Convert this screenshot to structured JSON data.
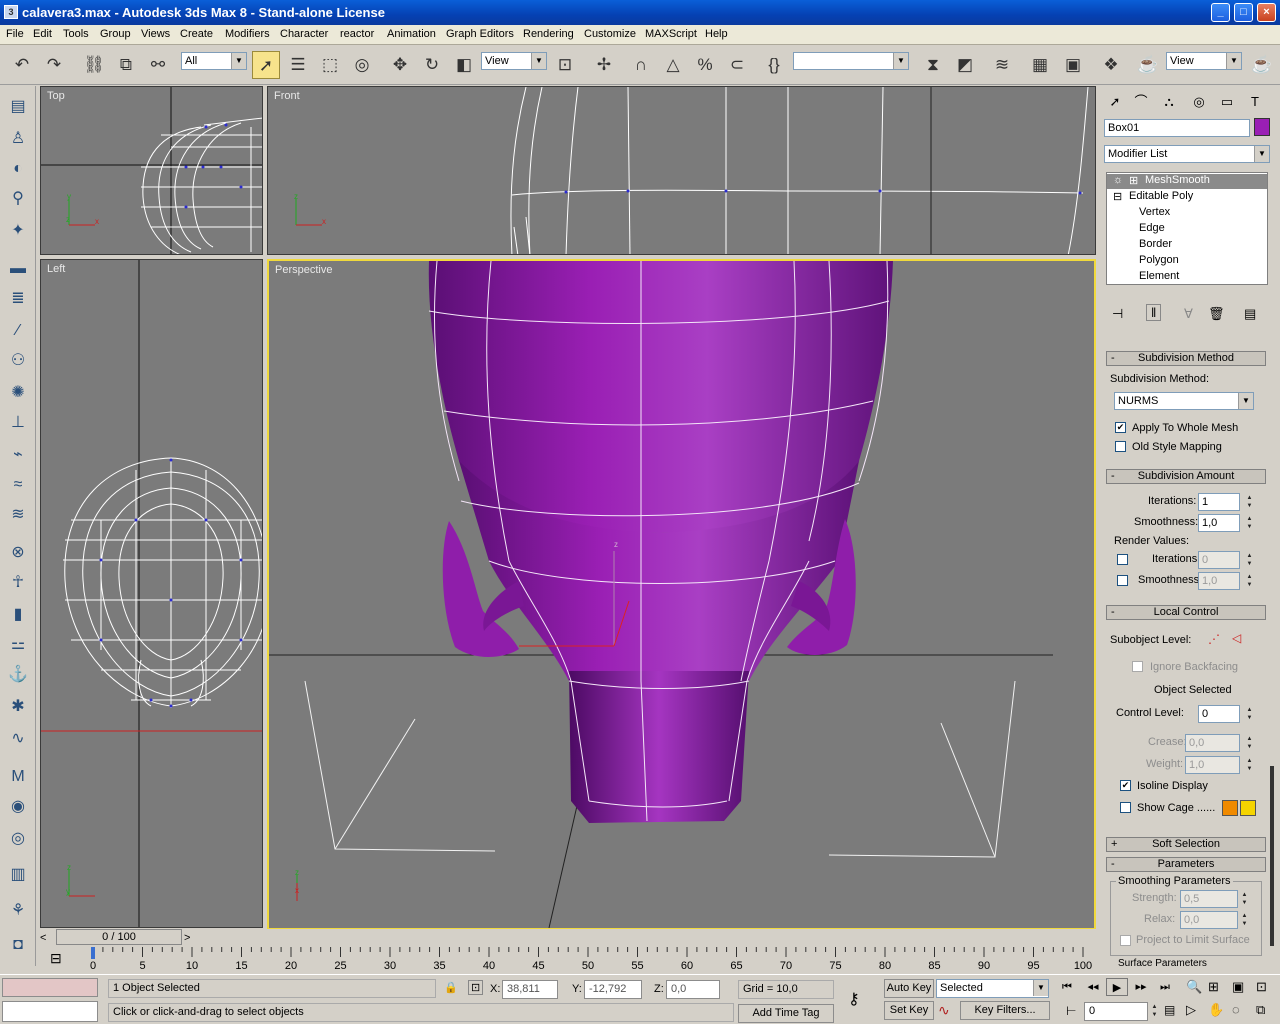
{
  "window": {
    "title": "calavera3.max - Autodesk 3ds Max 8  - Stand-alone License",
    "min": "_",
    "max": "□",
    "close": "×"
  },
  "menu": [
    "File",
    "Edit",
    "Tools",
    "Group",
    "Views",
    "Create",
    "Modifiers",
    "Character",
    "reactor",
    "Animation",
    "Graph Editors",
    "Rendering",
    "Customize",
    "MAXScript",
    "Help"
  ],
  "toolbar": {
    "selection_filter": "All",
    "ref_coord": "View",
    "named_selection": "",
    "render_type": "View"
  },
  "viewports": {
    "top": "Top",
    "front": "Front",
    "left": "Left",
    "perspective": "Perspective"
  },
  "command_panel": {
    "object_name": "Box01",
    "object_color": "#9a1fb4",
    "modifier_list": "Modifier List",
    "stack": [
      "MeshSmooth",
      "Editable Poly",
      "Vertex",
      "Edge",
      "Border",
      "Polygon",
      "Element"
    ],
    "subdivision_method": {
      "title": "Subdivision Method",
      "label": "Subdivision Method:",
      "value": "NURMS",
      "apply_whole_mesh": "Apply To Whole Mesh",
      "apply_whole_mesh_checked": true,
      "old_style_mapping": "Old Style Mapping",
      "old_style_mapping_checked": false
    },
    "subdivision_amount": {
      "title": "Subdivision Amount",
      "iterations_label": "Iterations:",
      "iterations": "1",
      "smoothness_label": "Smoothness:",
      "smoothness": "1,0",
      "render_values": "Render Values:",
      "r_iterations": "0",
      "r_smoothness": "1,0"
    },
    "local_control": {
      "title": "Local Control",
      "subobject_level": "Subobject Level:",
      "ignore_backfacing": "Ignore Backfacing",
      "object_selected": "Object Selected",
      "control_level_label": "Control Level:",
      "control_level": "0",
      "crease_label": "Crease:",
      "crease": "0,0",
      "weight_label": "Weight:",
      "weight": "1,0",
      "isoline_display": "Isoline Display",
      "isoline_checked": true,
      "show_cage": "Show Cage ......",
      "show_cage_checked": false,
      "cage_color_1": "#f08a00",
      "cage_color_2": "#f5d400"
    },
    "soft_selection": "Soft Selection",
    "parameters": "Parameters",
    "smoothing_parameters": "Smoothing Parameters",
    "strength_label": "Strength:",
    "strength": "0,5",
    "relax_label": "Relax:",
    "relax": "0,0",
    "project_limit": "Project to Limit Surface",
    "surface_parameters": "Surface Parameters"
  },
  "timeline": {
    "frame": "0 / 100",
    "ticks": [
      "0",
      "5",
      "10",
      "15",
      "20",
      "25",
      "30",
      "35",
      "40",
      "45",
      "50",
      "55",
      "60",
      "65",
      "70",
      "75",
      "80",
      "85",
      "90",
      "95",
      "100"
    ]
  },
  "status": {
    "selected": "1 Object Selected",
    "prompt": "Click or click-and-drag to select objects",
    "x_label": "X:",
    "x": "38,811",
    "y_label": "Y:",
    "y": "-12,792",
    "z_label": "Z:",
    "z": "0,0",
    "grid": "Grid = 10,0",
    "add_time_tag": "Add Time Tag",
    "auto_key": "Auto Key",
    "set_key": "Set Key",
    "key_mode": "Selected",
    "key_filters": "Key Filters...",
    "current_frame": "0"
  }
}
